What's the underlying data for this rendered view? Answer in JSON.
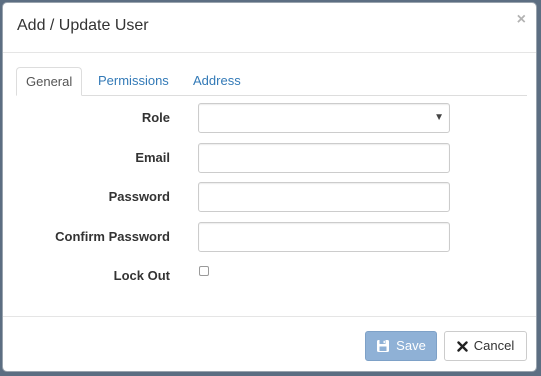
{
  "dialog": {
    "title": "Add / Update User",
    "close_glyph": "×"
  },
  "tabs": [
    {
      "label": "General",
      "active": true
    },
    {
      "label": "Permissions",
      "active": false
    },
    {
      "label": "Address",
      "active": false
    }
  ],
  "form": {
    "role": {
      "label": "Role",
      "value": ""
    },
    "email": {
      "label": "Email",
      "value": ""
    },
    "password": {
      "label": "Password",
      "value": ""
    },
    "confirm_password": {
      "label": "Confirm Password",
      "value": ""
    },
    "lock_out": {
      "label": "Lock Out",
      "checked": false
    }
  },
  "footer": {
    "save_label": "Save",
    "save_icon": "save-icon",
    "cancel_label": "Cancel",
    "cancel_icon": "close-icon"
  },
  "colors": {
    "link": "#337ab7",
    "save_button": "#8fb1d6"
  }
}
